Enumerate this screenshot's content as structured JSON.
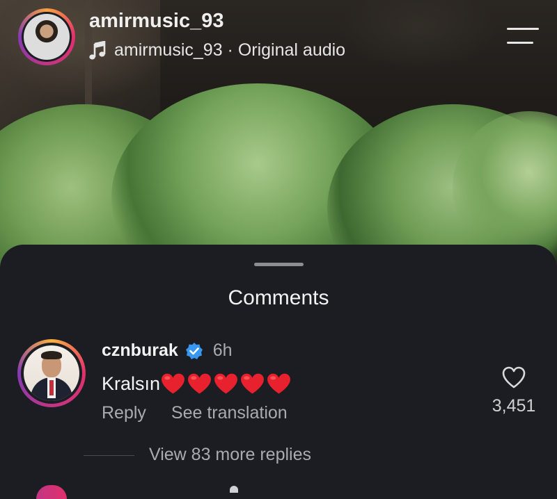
{
  "reel": {
    "username": "amirmusic_93",
    "audio_label": "amirmusic_93 · Original audio",
    "icons": {
      "music": "music-note-icon",
      "menu": "menu-icon"
    }
  },
  "comments": {
    "title": "Comments",
    "items": [
      {
        "username": "cznburak",
        "verified": true,
        "time": "6h",
        "text": "Kralsın",
        "emoji_count": 5,
        "emoji": "red-heart",
        "reply_label": "Reply",
        "translate_label": "See translation",
        "like_count": "3,451",
        "view_replies_label": "View 83 more replies"
      }
    ]
  },
  "colors": {
    "background": "#1b1d22",
    "secondary_text": "#a9abb0",
    "verified_blue": "#3897f0",
    "heart_red": "#e8212e"
  }
}
